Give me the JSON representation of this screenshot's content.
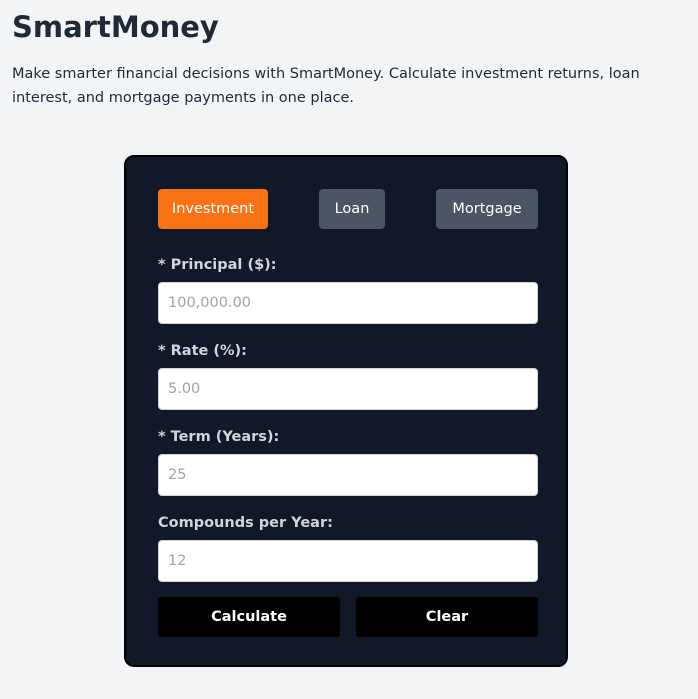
{
  "header": {
    "title": "SmartMoney",
    "subtitle": "Make smarter financial decisions with SmartMoney. Calculate investment returns, loan interest, and mortgage payments in one place."
  },
  "tabs": [
    {
      "label": "Investment",
      "active": true
    },
    {
      "label": "Loan",
      "active": false
    },
    {
      "label": "Mortgage",
      "active": false
    }
  ],
  "form": {
    "principal": {
      "label": "* Principal ($):",
      "value": "",
      "placeholder": "100,000.00"
    },
    "rate": {
      "label": "* Rate (%):",
      "value": "",
      "placeholder": "5.00"
    },
    "term": {
      "label": "* Term (Years):",
      "value": "",
      "placeholder": "25"
    },
    "compounds": {
      "label": "Compounds per Year:",
      "value": "",
      "placeholder": "12"
    }
  },
  "actions": {
    "calculate_label": "Calculate",
    "clear_label": "Clear"
  },
  "colors": {
    "page_background": "#f3f4f6",
    "card_background": "#111827",
    "active_tab": "#f97316",
    "inactive_tab": "#4b5563",
    "action_button": "#000000"
  }
}
